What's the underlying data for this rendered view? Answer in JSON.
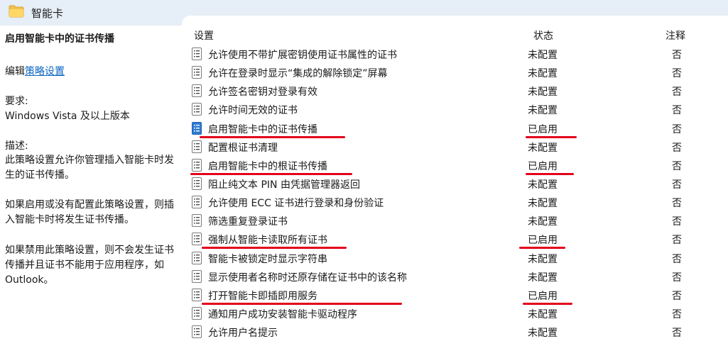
{
  "header": {
    "title": "智能卡",
    "icon": "folder-icon"
  },
  "left": {
    "policy_title": "启用智能卡中的证书传播",
    "edit_prefix": "编辑",
    "edit_link": "策略设置",
    "requirements_label": "要求:",
    "requirements_value": "Windows Vista 及以上版本",
    "description_label": "描述:",
    "paragraphs": [
      "此策略设置允许你管理插入智能卡时发生的证书传播。",
      "如果启用或没有配置此策略设置，则插入智能卡时将发生证书传播。",
      "如果禁用此策略设置，则不会发生证书传播并且证书不能用于应用程序，如 Outlook。"
    ]
  },
  "table": {
    "col_setting": "设置",
    "col_state": "状态",
    "col_comment": "注释",
    "rows": [
      {
        "name": "允许使用不带扩展密钥使用证书属性的证书",
        "state": "未配置",
        "comment": "否",
        "enabled": false
      },
      {
        "name": "允许在登录时显示“集成的解除锁定”屏幕",
        "state": "未配置",
        "comment": "否",
        "enabled": false
      },
      {
        "name": "允许签名密钥对登录有效",
        "state": "未配置",
        "comment": "否",
        "enabled": false
      },
      {
        "name": "允许时间无效的证书",
        "state": "未配置",
        "comment": "否",
        "enabled": false
      },
      {
        "name": "启用智能卡中的证书传播",
        "state": "已启用",
        "comment": "否",
        "enabled": true,
        "selected": true
      },
      {
        "name": "配置根证书清理",
        "state": "未配置",
        "comment": "否",
        "enabled": false
      },
      {
        "name": "启用智能卡中的根证书传播",
        "state": "已启用",
        "comment": "否",
        "enabled": true
      },
      {
        "name": "阻止纯文本 PIN 由凭据管理器返回",
        "state": "未配置",
        "comment": "否",
        "enabled": false
      },
      {
        "name": "允许使用 ECC 证书进行登录和身份验证",
        "state": "未配置",
        "comment": "否",
        "enabled": false
      },
      {
        "name": "筛选重复登录证书",
        "state": "未配置",
        "comment": "否",
        "enabled": false
      },
      {
        "name": "强制从智能卡读取所有证书",
        "state": "已启用",
        "comment": "否",
        "enabled": true
      },
      {
        "name": "智能卡被锁定时显示字符串",
        "state": "未配置",
        "comment": "否",
        "enabled": false
      },
      {
        "name": "显示使用者名称时还原存储在证书中的该名称",
        "state": "未配置",
        "comment": "否",
        "enabled": false
      },
      {
        "name": "打开智能卡即插即用服务",
        "state": "已启用",
        "comment": "否",
        "enabled": true
      },
      {
        "name": "通知用户成功安装智能卡驱动程序",
        "state": "未配置",
        "comment": "否",
        "enabled": false
      },
      {
        "name": "允许用户名提示",
        "state": "未配置",
        "comment": "否",
        "enabled": false
      }
    ]
  },
  "colors": {
    "annotation_red": "#e3001b",
    "link_blue": "#0a66c2",
    "header_bg": "#e6eef7"
  }
}
